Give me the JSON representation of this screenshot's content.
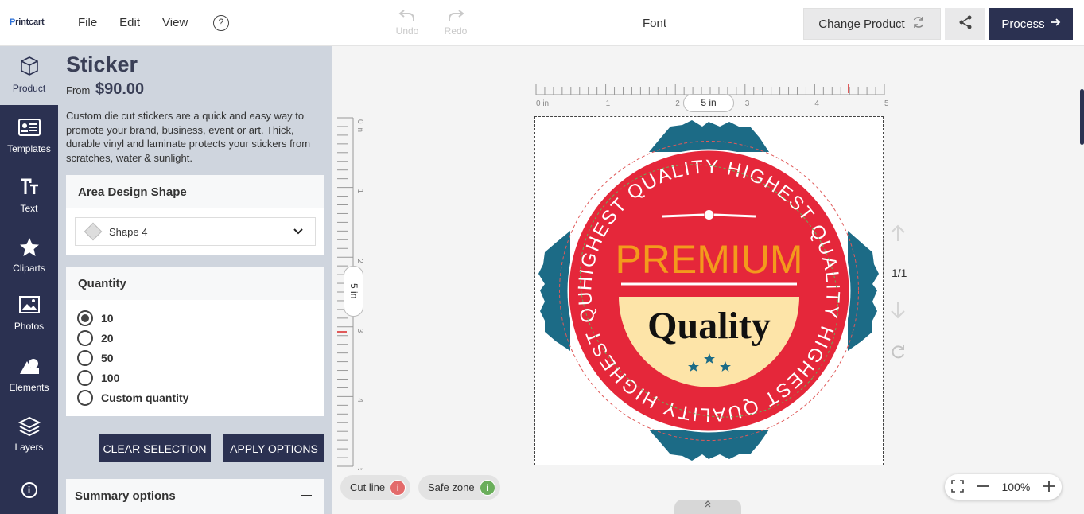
{
  "app": {
    "logo_prefix": "P",
    "logo_rest": "rintcart"
  },
  "menu": {
    "file": "File",
    "edit": "Edit",
    "view": "View",
    "help": "?"
  },
  "toolbar": {
    "undo": "Undo",
    "redo": "Redo",
    "font": "Font"
  },
  "actions": {
    "change_product": "Change Product",
    "process": "Process"
  },
  "nav": {
    "product": "Product",
    "templates": "Templates",
    "text": "Text",
    "cliparts": "Cliparts",
    "photos": "Photos",
    "elements": "Elements",
    "layers": "Layers",
    "info": "i"
  },
  "panel": {
    "title": "Sticker",
    "from_label": "From",
    "price": "$90.00",
    "description": "Custom die cut stickers are a quick and easy way to promote your brand, business, event or art. Thick, durable vinyl and laminate protects your stickers from scratches, water & sunlight.",
    "area_design_shape": {
      "header": "Area Design Shape",
      "selected": "Shape 4"
    },
    "quantity": {
      "header": "Quantity",
      "options": [
        "10",
        "20",
        "50",
        "100",
        "Custom quantity"
      ],
      "selected_index": 0
    },
    "clear_selection": "CLEAR SELECTION",
    "apply_options": "APPLY OPTIONS",
    "summary": "Summary options"
  },
  "canvas": {
    "ruler_h_labels": [
      "0 in",
      "1",
      "2",
      "3",
      "4",
      "5"
    ],
    "ruler_v_labels": [
      "0 in",
      "1",
      "2",
      "3",
      "4",
      "5"
    ],
    "width_pill": "5 in",
    "height_pill": "5 in",
    "page_count": "1/1",
    "design": {
      "ring_text": "HIGHEST QUALITY HIGHEST QUALITY HIGHEST QUALITY HIGHEST QUALITY",
      "headline": "PREMIUM",
      "subline": "Quality"
    }
  },
  "bottom": {
    "cut_line": "Cut line",
    "safe_zone": "Safe zone",
    "zoom": "100%",
    "info_glyph": "i"
  },
  "colors": {
    "navy": "#2b3151",
    "panel_bg": "#cfd5de",
    "badge_red": "#e5273a",
    "badge_teal": "#1c6b86",
    "headline_orange": "#f39a1c",
    "cream": "#fde4a8",
    "cut_line": "#e05a5a",
    "safe_zone": "#6aae5b"
  }
}
